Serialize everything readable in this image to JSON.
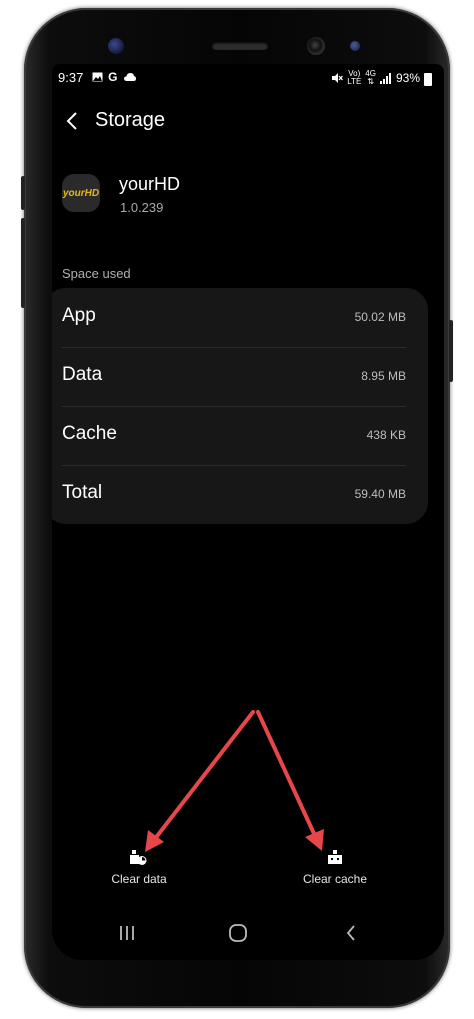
{
  "status_bar": {
    "time": "9:37",
    "left_icons": [
      "gallery-icon",
      "google-icon",
      "cloud-icon"
    ],
    "network_top": "Vo)",
    "network_bottom": "LTE",
    "gen_top": "4G",
    "battery": "93%"
  },
  "header": {
    "title": "Storage"
  },
  "app": {
    "icon_text": "yourHD",
    "name": "yourHD",
    "version": "1.0.239"
  },
  "storage": {
    "section_label": "Space used",
    "rows": [
      {
        "label": "App",
        "value": "50.02 MB"
      },
      {
        "label": "Data",
        "value": "8.95 MB"
      },
      {
        "label": "Cache",
        "value": "438 KB"
      },
      {
        "label": "Total",
        "value": "59.40 MB"
      }
    ]
  },
  "actions": {
    "clear_data": "Clear data",
    "clear_cache": "Clear cache"
  },
  "colors": {
    "annotation_arrow": "#e8474a",
    "app_icon_text": "#e6b81e",
    "card_background": "#171717"
  }
}
